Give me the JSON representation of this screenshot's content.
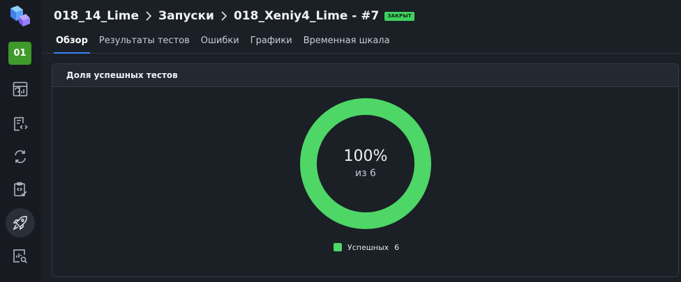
{
  "sidebar": {
    "project_badge": "01",
    "items": [
      {
        "icon": "dashboard-icon"
      },
      {
        "icon": "test-cases-icon"
      },
      {
        "icon": "sync-icon"
      },
      {
        "icon": "test-plans-icon"
      },
      {
        "icon": "launches-rocket-icon",
        "active": true
      },
      {
        "icon": "reports-search-icon"
      }
    ]
  },
  "header": {
    "breadcrumb": [
      "018_14_Lime",
      "Запуски",
      "018_Xeniy4_Lime - #7"
    ],
    "status_badge": "ЗАКРЫТ",
    "tabs": [
      {
        "label": "Обзор",
        "active": true
      },
      {
        "label": "Результаты тестов"
      },
      {
        "label": "Ошибки"
      },
      {
        "label": "Графики"
      },
      {
        "label": "Временная шкала"
      }
    ]
  },
  "card": {
    "title": "Доля успешных тестов",
    "donut": {
      "percent_label": "100%",
      "sub_label": "из 6"
    },
    "legend": {
      "label": "Успешных",
      "count": "6"
    }
  },
  "chart_data": {
    "type": "pie",
    "categories": [
      "Успешных"
    ],
    "values": [
      6
    ],
    "colors": [
      "#4ed667"
    ],
    "title": "Доля успешных тестов"
  },
  "colors": {
    "background": "#1b1f26",
    "sidebar": "#171b21",
    "accent_tab": "#3b82f6",
    "success": "#4ed667",
    "project_badge": "#3f9a2b"
  }
}
